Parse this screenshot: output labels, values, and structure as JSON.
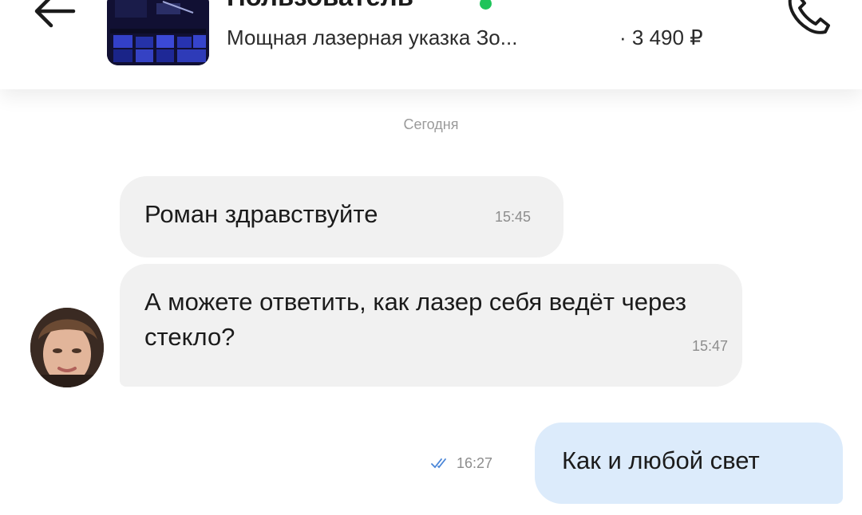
{
  "header": {
    "back_icon": "arrow-left-icon",
    "user_name": "Пользователь",
    "online_color": "#1ec45a",
    "item_title": "Мощная лазерная указка Зо...",
    "item_price": "· 3 490 ₽",
    "call_icon": "phone-icon"
  },
  "chat": {
    "date_separator": "Сегодня",
    "messages": [
      {
        "direction": "incoming",
        "text": "Роман здравствуйте",
        "time": "15:45"
      },
      {
        "direction": "incoming",
        "text": "А можете ответить, как лазер себя ведёт через стекло?",
        "time": "15:47"
      },
      {
        "direction": "outgoing",
        "text": "Как и любой свет",
        "time": "16:27",
        "status_icon": "double-check-icon"
      }
    ]
  },
  "colors": {
    "incoming_bubble": "#f1f1f1",
    "outgoing_bubble": "#dcebfb",
    "read_checks": "#4a86d8"
  }
}
